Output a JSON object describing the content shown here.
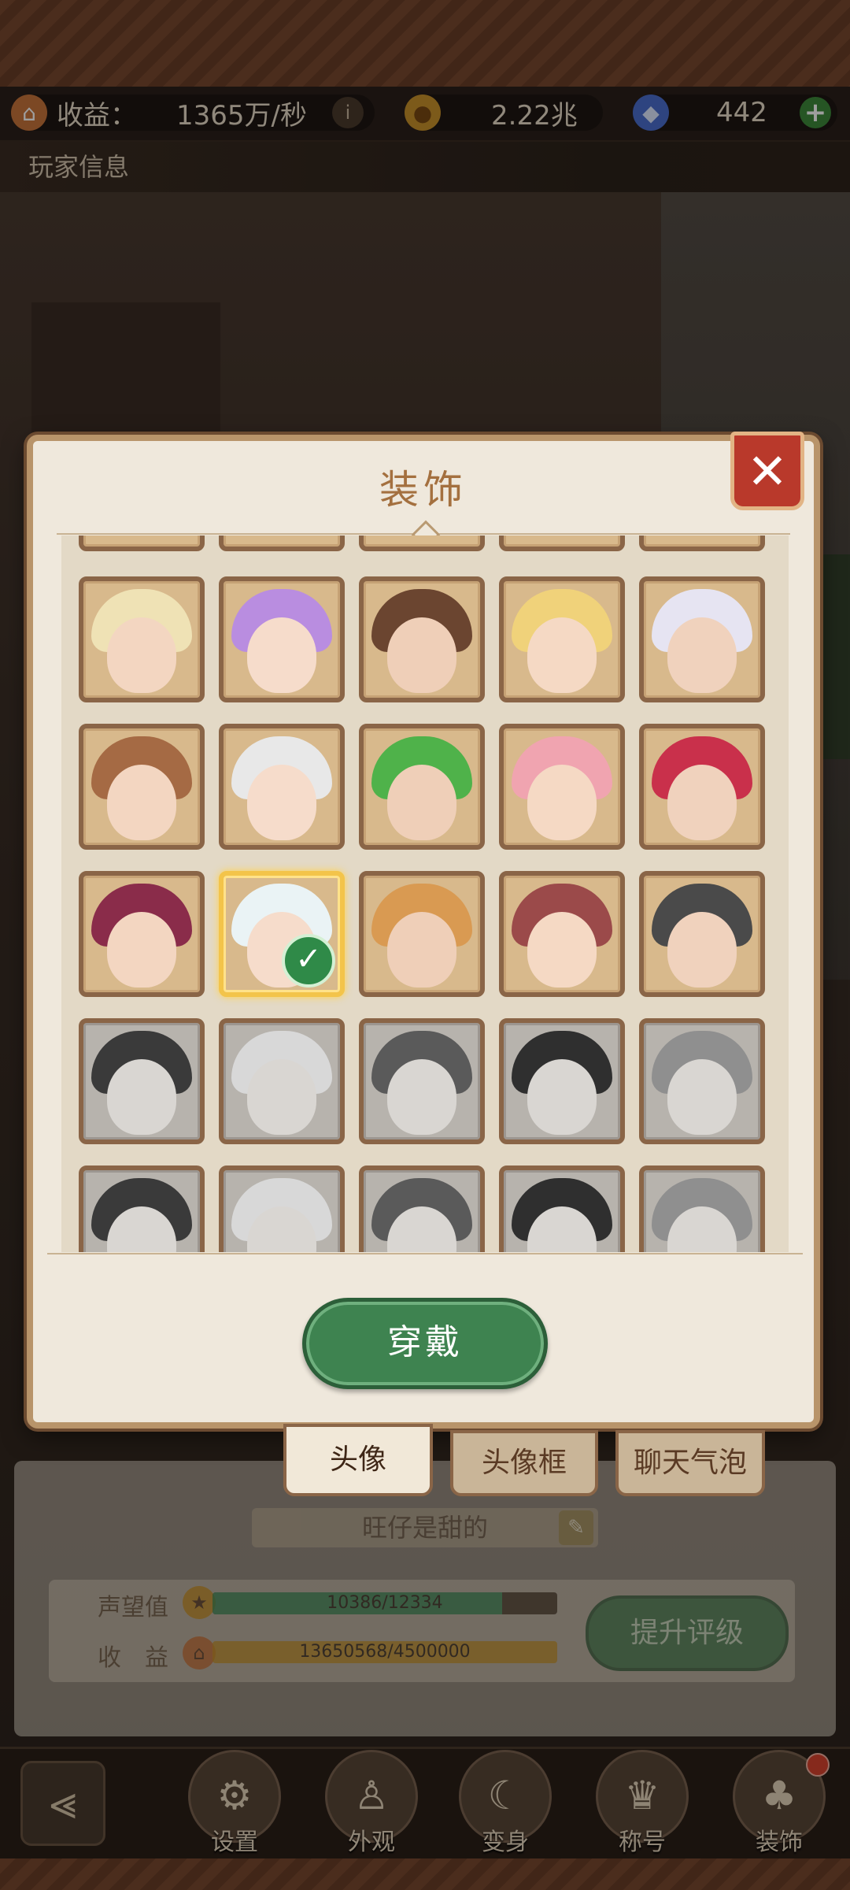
{
  "status": {
    "income_label": "收益：",
    "income_value": "1365万/秒",
    "coins_value": "2.22兆",
    "gems_value": "442"
  },
  "page_title": "玩家信息",
  "modal": {
    "title": "装饰",
    "close_symbol": "✕",
    "wear_label": "穿戴",
    "tabs": [
      "头像",
      "头像框",
      "聊天气泡"
    ],
    "active_tab": "头像"
  },
  "avatars": {
    "rows": 5,
    "columns": 5,
    "selected": {
      "row": 3,
      "column": 2
    },
    "locked_from_row": 3,
    "check_symbol": "✓"
  },
  "profile": {
    "name": "旺仔是甜的",
    "prestige_label": "声望值",
    "prestige_value": "10386/12334",
    "prestige_fraction": 0.84,
    "income_label": "收　益",
    "income_value": "13650568/4500000",
    "income_fraction": 1.0,
    "upgrade_label": "提升评级"
  },
  "nav": {
    "back_symbol": "⪡",
    "items": [
      "设置",
      "外观",
      "变身",
      "称号",
      "装饰"
    ]
  },
  "colors": {
    "accent_green": "#3e8350",
    "close_red": "#b9392b",
    "frame_brown": "#8a6547",
    "selected_gold": "#f3c44a"
  }
}
